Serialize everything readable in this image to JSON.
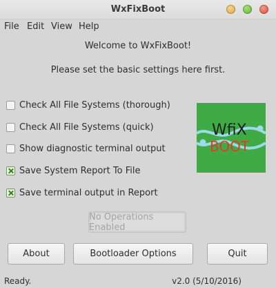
{
  "window": {
    "title": "WxFixBoot"
  },
  "menu": {
    "file": "File",
    "edit": "Edit",
    "view": "View",
    "help": "Help"
  },
  "main": {
    "welcome": "Welcome to WxFixBoot!",
    "instructions": "Please set the basic settings here first."
  },
  "options": [
    {
      "label": "Check All File Systems (thorough)",
      "checked": false
    },
    {
      "label": "Check All File Systems (quick)",
      "checked": false
    },
    {
      "label": "Show diagnostic terminal output",
      "checked": false
    },
    {
      "label": "Save System Report To File",
      "checked": true
    },
    {
      "label": "Save terminal output in Report",
      "checked": true
    }
  ],
  "logo": {
    "line1": "WfiX",
    "line2": "BOOT",
    "background_color": "#3fab45",
    "text_color": "#e23a2a",
    "wave_color": "#9fd8e8"
  },
  "buttons": {
    "operations": "No Operations Enabled",
    "about": "About",
    "bootloader": "Bootloader Options",
    "quit": "Quit"
  },
  "status": {
    "text": "Ready.",
    "version": "v2.0 (5/10/2016)"
  }
}
